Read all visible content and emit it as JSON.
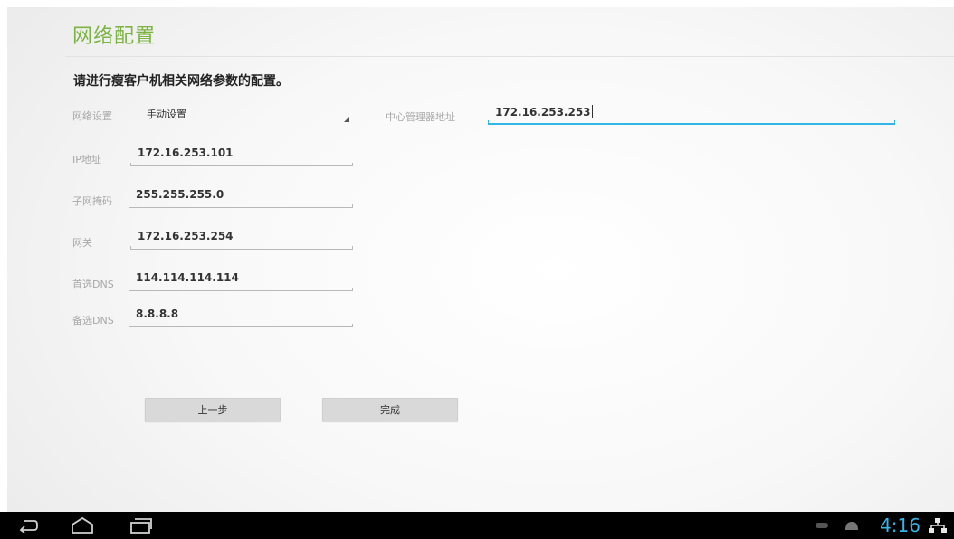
{
  "page": {
    "title": "网络配置",
    "instruction": "请进行瘦客户机相关网络参数的配置。"
  },
  "form": {
    "network_setting": {
      "label": "网络设置",
      "value": "手动设置"
    },
    "ip": {
      "label": "IP地址",
      "value": "172.16.253.101"
    },
    "subnet": {
      "label": "子网掩码",
      "value": "255.255.255.0"
    },
    "gateway": {
      "label": "网关",
      "value": "172.16.253.254"
    },
    "dns1": {
      "label": "首选DNS",
      "value": "114.114.114.114"
    },
    "dns2": {
      "label": "备选DNS",
      "value": "8.8.8.8"
    },
    "manager": {
      "label": "中心管理器地址",
      "value": "172.16.253.253"
    }
  },
  "buttons": {
    "prev": "上一步",
    "done": "完成"
  },
  "status_bar": {
    "time": "4:16",
    "accent_color": "#33b5e5",
    "icons": [
      "back-icon",
      "home-icon",
      "recent-apps-icon",
      "usb-icon",
      "android-debug-icon",
      "network-icon"
    ]
  },
  "colors": {
    "title": "#7cb342",
    "focus": "#33b5e5"
  }
}
